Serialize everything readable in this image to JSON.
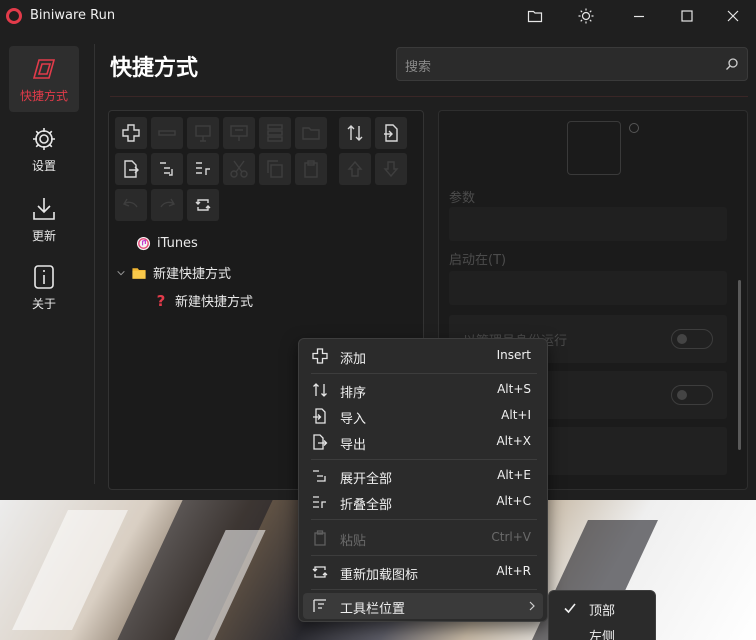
{
  "window": {
    "title": "Biniware Run",
    "brand_color": "#e23b4a"
  },
  "titlebar_buttons": [
    "folder-icon",
    "theme-sun-icon",
    "minimize-icon",
    "maximize-icon",
    "close-icon"
  ],
  "nav": {
    "items": [
      {
        "label": "快捷方式",
        "icon": "shortcut-icon",
        "active": true
      },
      {
        "label": "设置",
        "icon": "gear-icon",
        "active": false
      },
      {
        "label": "更新",
        "icon": "download-icon",
        "active": false
      },
      {
        "label": "关于",
        "icon": "info-icon",
        "active": false
      }
    ]
  },
  "page": {
    "title": "快捷方式",
    "search_placeholder": "搜索"
  },
  "toolbar": [
    {
      "icon": "add-icon",
      "enabled": true
    },
    {
      "icon": "remove-icon",
      "enabled": false
    },
    {
      "icon": "edit-icon",
      "enabled": false
    },
    {
      "icon": "rename-icon",
      "enabled": false
    },
    {
      "icon": "list-icon",
      "enabled": false
    },
    {
      "icon": "open-folder-icon",
      "enabled": false
    },
    {
      "icon": "sort-icon",
      "enabled": true
    },
    {
      "icon": "import-icon",
      "enabled": true
    },
    {
      "icon": "export-icon",
      "enabled": true
    },
    {
      "icon": "expand-all-icon",
      "enabled": true
    },
    {
      "icon": "collapse-all-icon",
      "enabled": true
    },
    {
      "icon": "cut-icon",
      "enabled": false
    },
    {
      "icon": "copy-icon",
      "enabled": false
    },
    {
      "icon": "paste-icon",
      "enabled": false
    },
    {
      "icon": "move-up-icon",
      "enabled": false
    },
    {
      "icon": "move-down-icon",
      "enabled": false
    },
    {
      "icon": "undo-icon",
      "enabled": false
    },
    {
      "icon": "redo-icon",
      "enabled": false
    },
    {
      "icon": "reload-icons-icon",
      "enabled": true
    }
  ],
  "tree": {
    "item_itunes": "iTunes",
    "folder": "新建快捷方式",
    "child": "新建快捷方式"
  },
  "details": {
    "label_params": "参数",
    "label_start_in": "启动在(T)",
    "option_admin": "以管理员身份运行"
  },
  "context_menu": {
    "items": [
      {
        "label": "添加",
        "shortcut": "Insert",
        "icon": "add-icon",
        "enabled": true
      },
      {
        "label": "排序",
        "shortcut": "Alt+S",
        "icon": "sort-icon",
        "enabled": true
      },
      {
        "label": "导入",
        "shortcut": "Alt+I",
        "icon": "import-icon",
        "enabled": true
      },
      {
        "label": "导出",
        "shortcut": "Alt+X",
        "icon": "export-icon",
        "enabled": true
      },
      {
        "label": "展开全部",
        "shortcut": "Alt+E",
        "icon": "expand-all-icon",
        "enabled": true
      },
      {
        "label": "折叠全部",
        "shortcut": "Alt+C",
        "icon": "collapse-all-icon",
        "enabled": true
      },
      {
        "label": "粘贴",
        "shortcut": "Ctrl+V",
        "icon": "paste-icon",
        "enabled": false
      },
      {
        "label": "重新加载图标",
        "shortcut": "Alt+R",
        "icon": "reload-icons-icon",
        "enabled": true
      },
      {
        "label": "工具栏位置",
        "shortcut": "",
        "icon": "toolbar-position-icon",
        "enabled": true
      }
    ]
  },
  "submenu": {
    "items": [
      {
        "label": "顶部",
        "checked": true
      },
      {
        "label": "左侧",
        "checked": false
      }
    ]
  }
}
